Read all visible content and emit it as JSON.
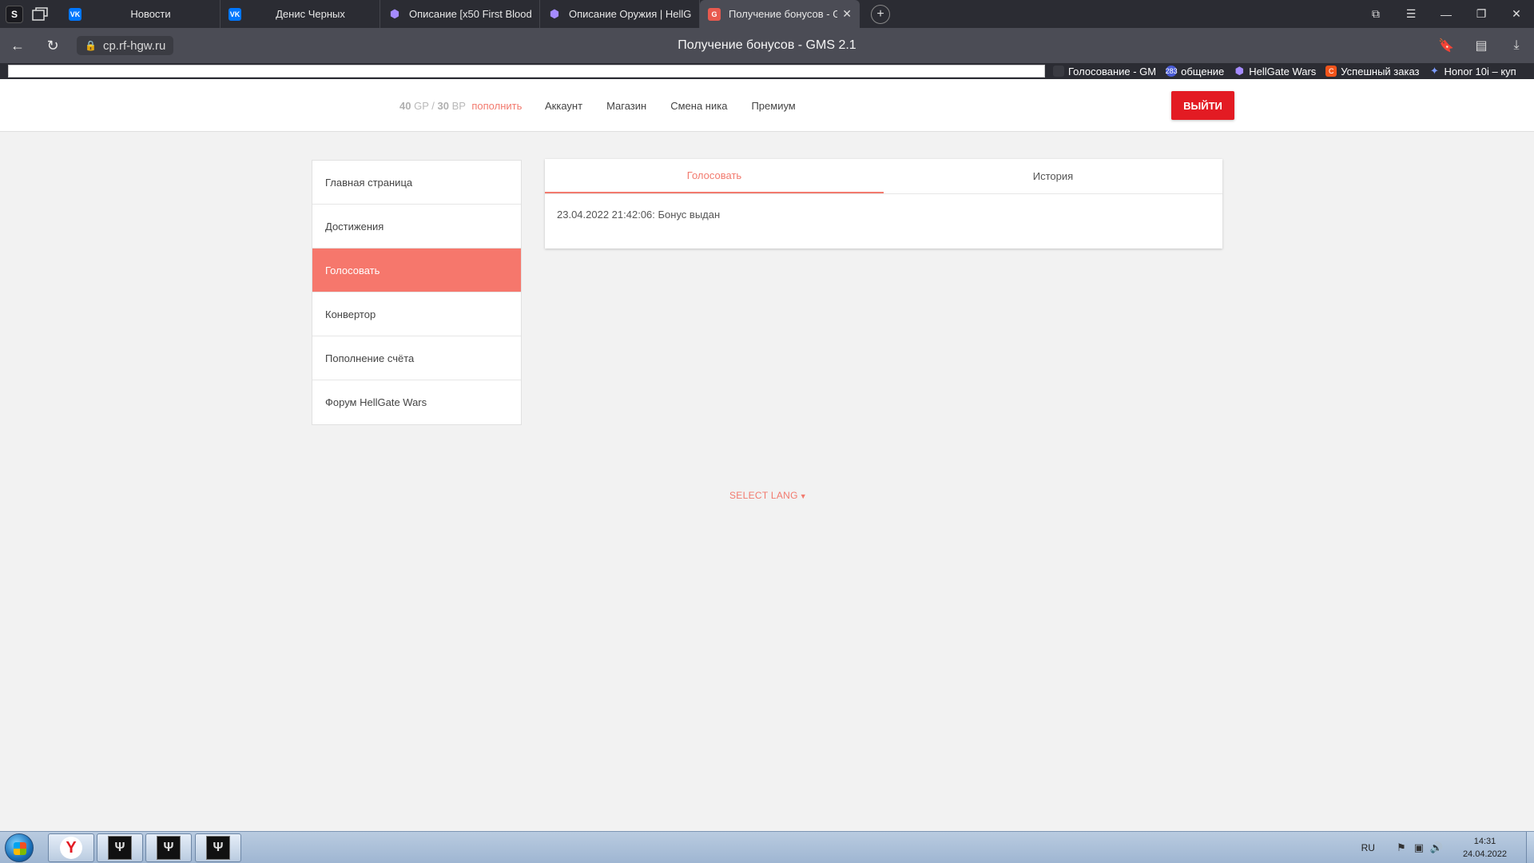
{
  "browser": {
    "tabs": [
      {
        "label": "Новости",
        "favicon": "vk-icon"
      },
      {
        "label": "Денис Черных",
        "favicon": "vk-icon"
      },
      {
        "label": "Описание [x50 First Blood",
        "favicon": "hexagon-icon"
      },
      {
        "label": "Описание Оружия | HellG",
        "favicon": "hexagon-icon"
      },
      {
        "label": "Получение бонусов - G",
        "favicon": "gms-icon",
        "active": true
      }
    ],
    "url": "cp.rf-hgw.ru",
    "page_title": "Получение бонусов - GMS 2.1",
    "bookmarks": [
      {
        "label": "Голосование - GM"
      },
      {
        "label": "общение",
        "badge": "283"
      },
      {
        "label": "HellGate Wars"
      },
      {
        "label": "Успешный заказ"
      },
      {
        "label": "Honor 10i – куп"
      }
    ]
  },
  "header": {
    "balance_gp": "40",
    "gp_unit": "GP",
    "separator": "/",
    "balance_bp": "30",
    "bp_unit": "BP",
    "topup_label": "пополнить",
    "nav": [
      "Аккаунт",
      "Магазин",
      "Смена ника",
      "Премиум"
    ],
    "logout_label": "ВЫЙТИ",
    "accent_color": "#e31b23"
  },
  "sidebar": {
    "items": [
      {
        "label": "Главная страница"
      },
      {
        "label": "Достижения"
      },
      {
        "label": "Голосовать",
        "active": true
      },
      {
        "label": "Конвертор"
      },
      {
        "label": "Пополнение счёта"
      },
      {
        "label": "Форум HellGate Wars"
      }
    ],
    "active_color": "#f6776c"
  },
  "panel": {
    "tabs": [
      {
        "label": "Голосовать",
        "active": true
      },
      {
        "label": "История"
      }
    ],
    "log_entry": "23.04.2022 21:42:06: Бонус выдан"
  },
  "footer": {
    "lang_label": "SELECT LANG"
  },
  "taskbar": {
    "language": "RU",
    "time": "14:31",
    "date": "24.04.2022"
  }
}
